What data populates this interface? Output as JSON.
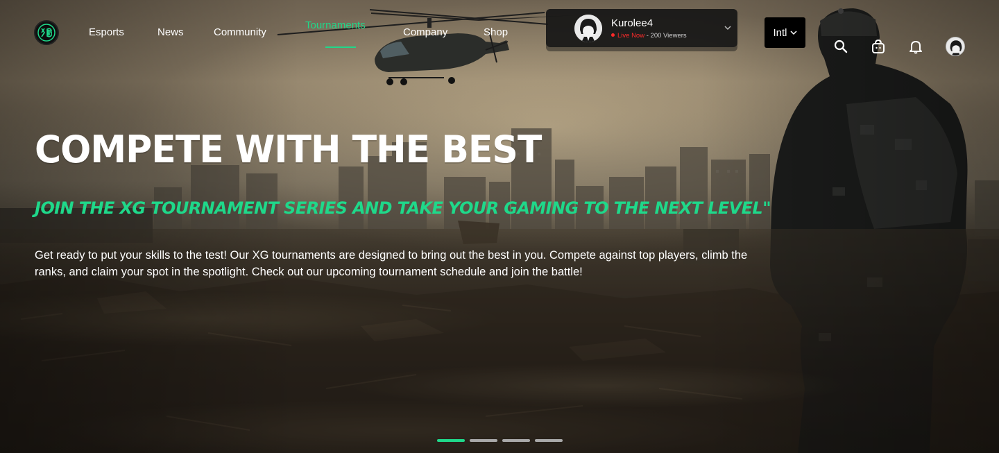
{
  "brand": {
    "logo_text": "XG",
    "accent": "#1fd88a"
  },
  "nav": {
    "items": [
      {
        "label": "Esports",
        "active": false
      },
      {
        "label": "News",
        "active": false
      },
      {
        "label": "Community",
        "active": false
      },
      {
        "label": "Tournaments",
        "active": true
      },
      {
        "label": "Company",
        "active": false
      },
      {
        "label": "Shop",
        "active": false
      }
    ]
  },
  "live": {
    "username": "Kurolee4",
    "status": "Live Now",
    "separator": " - ",
    "viewers": "200 Viewers",
    "status_color": "#ff2a2a"
  },
  "language": {
    "selected": "Intl"
  },
  "header_icons": [
    "search-icon",
    "cart-icon",
    "bell-icon"
  ],
  "hero": {
    "headline": "COMPETE WITH THE BEST",
    "subhead": "JOIN THE XG TOURNAMENT SERIES AND TAKE YOUR GAMING TO THE NEXT LEVEL\"",
    "body": "Get ready to put your skills to the test! Our XG tournaments are designed to bring out the best in you. Compete against top players, climb the ranks, and claim your spot in the spotlight. Check out our upcoming tournament schedule and join the battle!"
  },
  "carousel": {
    "slides": 4,
    "active_index": 0
  }
}
